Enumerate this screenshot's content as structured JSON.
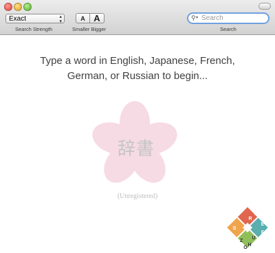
{
  "window": {
    "title": ""
  },
  "toolbar": {
    "search_strength": {
      "selected": "Exact",
      "label": "Search Strength"
    },
    "text_size": {
      "smaller_glyph": "A",
      "bigger_glyph": "A",
      "label": "Smaller Bigger"
    },
    "search": {
      "placeholder": "Search",
      "value": "",
      "label": "Search"
    }
  },
  "main": {
    "prompt_line1": "Type a word in English, Japanese, French,",
    "prompt_line2": "German, or Russian to begin...",
    "logo_text": "辞書",
    "status": "(Unregistered)"
  },
  "corner_logo": {
    "letters": [
      "J",
      "E",
      "F",
      "S",
      "R",
      "U",
      "Z",
      "H",
      "O"
    ]
  },
  "colors": {
    "accent": "#6ea0de",
    "blossom": "#f6dbe4",
    "logo_red": "#e0664f",
    "logo_teal": "#5aaeae",
    "logo_orange": "#f0a44c",
    "logo_green": "#8fbf5a"
  },
  "icons": [
    "close-icon",
    "minimize-icon",
    "zoom-icon",
    "search-icon",
    "dropdown-arrows-icon"
  ]
}
